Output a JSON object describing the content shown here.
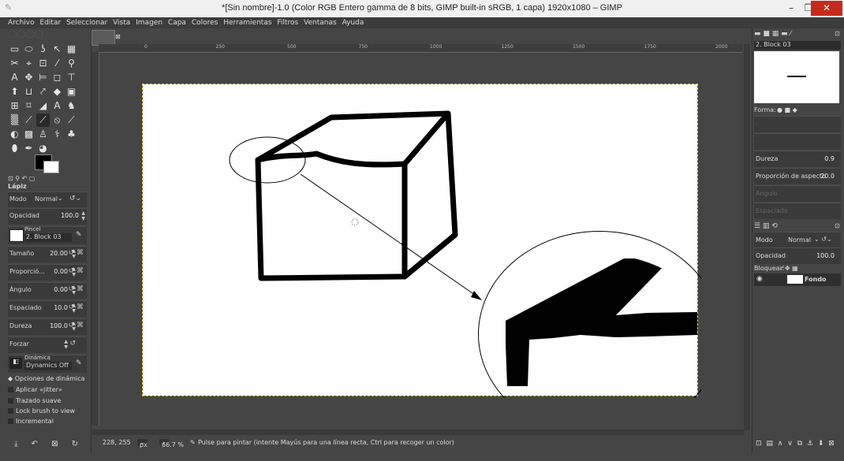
{
  "window": {
    "title": "*[Sin nombre]-1.0 (Color RGB Entero gamma de 8 bits, GIMP built-in sRGB, 1 capa) 1920x1080 – GIMP",
    "controls": {
      "minimize": "–",
      "maximize": "❐",
      "close": "✕"
    }
  },
  "menu": [
    "Archivo",
    "Editar",
    "Seleccionar",
    "Vista",
    "Imagen",
    "Capa",
    "Colores",
    "Herramientas",
    "Filtros",
    "Ventanas",
    "Ayuda"
  ],
  "toolbox": {
    "tools": [
      "▭",
      "⬭",
      "ʖ",
      "↖",
      "▦",
      "✂",
      "⌖",
      "⊡",
      "⁄",
      "⚲",
      "A",
      "✥",
      "⊨",
      "◻",
      "⊤",
      "⬆",
      "⊔",
      "⤤",
      "◆",
      "▣",
      "⊞",
      "⌑",
      "◢",
      "A",
      "♞",
      "▒",
      "⟋",
      "⟋",
      "⦸",
      "⟋",
      "◐",
      "▩",
      "♙",
      "⚕",
      "♣",
      "⬮",
      "✒",
      "◕"
    ],
    "tool_name": "Lápiz",
    "mode_label": "Modo",
    "mode_value": "Normal",
    "opacity_label": "Opacidad",
    "opacity_value": "100.0",
    "brush_label": "Pincel",
    "brush_value": "2. Block 03",
    "size_label": "Tamaño",
    "size_value": "20.00",
    "aspect_label": "Proporció...",
    "aspect_value": "0.00",
    "angle_label": "Ángulo",
    "angle_value": "0.00",
    "spacing_label": "Espaciado",
    "spacing_value": "10.0",
    "hardness_label": "Dureza",
    "hardness_value": "100.0",
    "force_label": "Forzar",
    "dynamics_label": "Dinámica",
    "dynamics_value": "Dynamics Off",
    "options": [
      "Opciones de dinámica",
      "Aplicar «jitter»",
      "Trazado suave",
      "Lock brush to view",
      "Incremental"
    ],
    "bottom_icons": [
      "⤓",
      "↶",
      "⊠",
      "↻"
    ]
  },
  "ruler": {
    "h_labels": [
      "0",
      "250",
      "500",
      "750",
      "1000",
      "1250",
      "1500",
      "1750",
      "2000"
    ]
  },
  "status": {
    "coords": "228, 255",
    "unit": "px",
    "zoom": "66.7 %",
    "message": "Pulse para pintar (intente Mayús para una línea recta, Ctrl para recoger un color)"
  },
  "right_dock": {
    "brush_name": "2. Block 03",
    "shape_label": "Forma:",
    "hardness_label": "Dureza",
    "hardness_value": "0.9",
    "aspect_label": "Proporción de aspecto",
    "aspect_value": "20.0",
    "angle_label": "Ángulo",
    "spacing_label": "Espaciado",
    "layers_mode_label": "Modo",
    "layers_mode_value": "Normal",
    "layers_opacity_label": "Opacidad",
    "layers_opacity_value": "100.0",
    "lock_label": "Bloquear:",
    "layer_name": "Fondo"
  },
  "colors": {
    "foreground": "#000000",
    "background": "#ffffff",
    "accent_close": "#c42b1c",
    "dark_bg": "#454545"
  }
}
